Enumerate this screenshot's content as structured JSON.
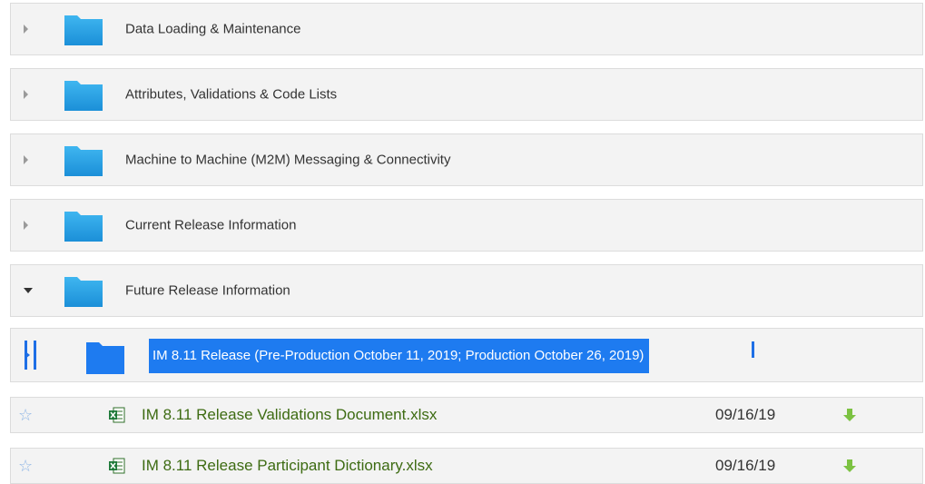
{
  "folders": [
    {
      "label": "Data Loading & Maintenance",
      "expanded": false
    },
    {
      "label": "Attributes, Validations & Code Lists",
      "expanded": false
    },
    {
      "label": "Machine to Machine (M2M) Messaging & Connectivity",
      "expanded": false
    },
    {
      "label": "Current Release Information",
      "expanded": false
    },
    {
      "label": "Future Release Information",
      "expanded": true
    }
  ],
  "subfolder": {
    "label": "IM 8.11 Release (Pre-Production October 11, 2019; Production October 26, 2019)",
    "selected": true
  },
  "files": [
    {
      "name": "IM 8.11 Release Validations Document.xlsx",
      "date": "09/16/19",
      "icon": "excel-file-icon"
    },
    {
      "name": "IM 8.11 Release Participant Dictionary.xlsx",
      "date": "09/16/19",
      "icon": "excel-file-icon"
    }
  ],
  "colors": {
    "folder": "#2aa3e8",
    "selection": "#1e7bf0",
    "file_link": "#3d6b12",
    "download_arrow": "#7cc242",
    "star": "#8fb6e6"
  }
}
